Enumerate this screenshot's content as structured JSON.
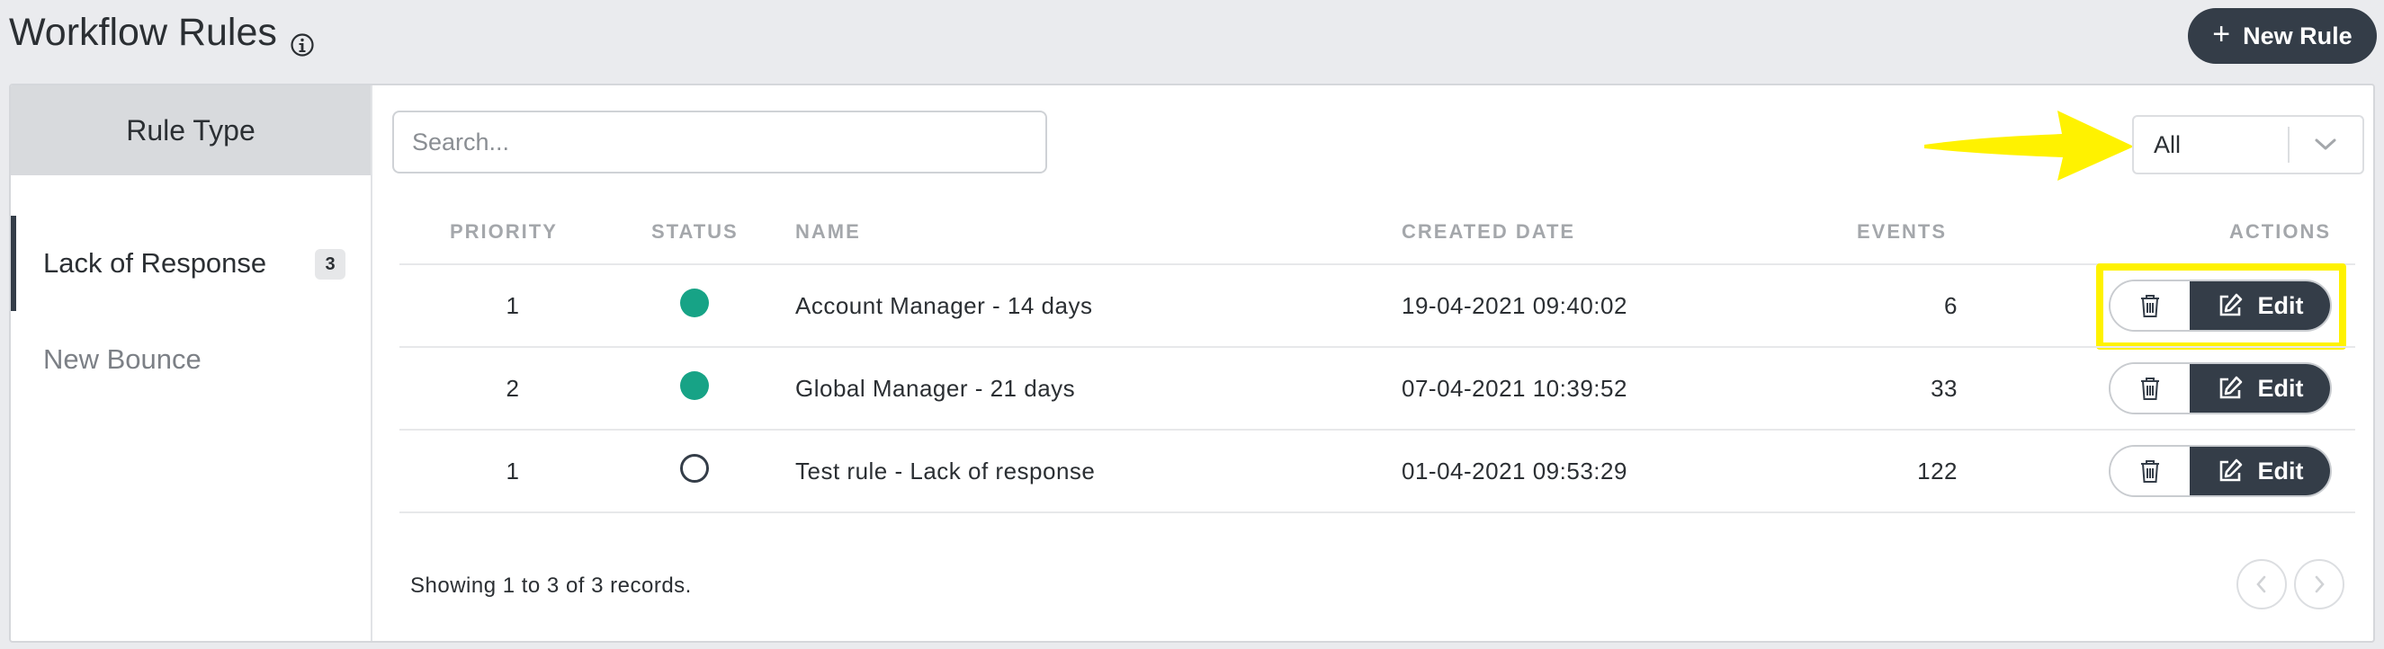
{
  "header": {
    "title": "Workflow Rules",
    "new_rule_label": "New Rule"
  },
  "sidebar": {
    "header": "Rule Type",
    "items": [
      {
        "label": "Lack of Response",
        "count": "3",
        "active": true
      },
      {
        "label": "New Bounce",
        "active": false
      }
    ]
  },
  "search": {
    "placeholder": "Search...",
    "value": ""
  },
  "filter": {
    "selected": "All"
  },
  "table": {
    "columns": [
      "PRIORITY",
      "STATUS",
      "NAME",
      "CREATED DATE",
      "EVENTS",
      "ACTIONS"
    ],
    "rows": [
      {
        "priority": "1",
        "status": "active",
        "name": "Account Manager - 14 days",
        "created": "19-04-2021 09:40:02",
        "events": "6",
        "edit_label": "Edit"
      },
      {
        "priority": "2",
        "status": "active",
        "name": "Global Manager - 21 days",
        "created": "07-04-2021 10:39:52",
        "events": "33",
        "edit_label": "Edit"
      },
      {
        "priority": "1",
        "status": "inactive",
        "name": "Test rule - Lack of response",
        "created": "01-04-2021 09:53:29",
        "events": "122",
        "edit_label": "Edit"
      }
    ]
  },
  "footer": {
    "showing": "Showing 1 to 3 of 3 records."
  },
  "colors": {
    "primary": "#343d48",
    "status_active": "#17a386",
    "highlight": "#fff200"
  },
  "icons": {
    "info": "info-icon",
    "plus": "plus-icon",
    "chevron": "chevron-down-icon",
    "trash": "trash-icon",
    "edit": "edit-icon",
    "prev": "chevron-left-icon",
    "next": "chevron-right-icon",
    "arrow": "arrow-annotation"
  }
}
